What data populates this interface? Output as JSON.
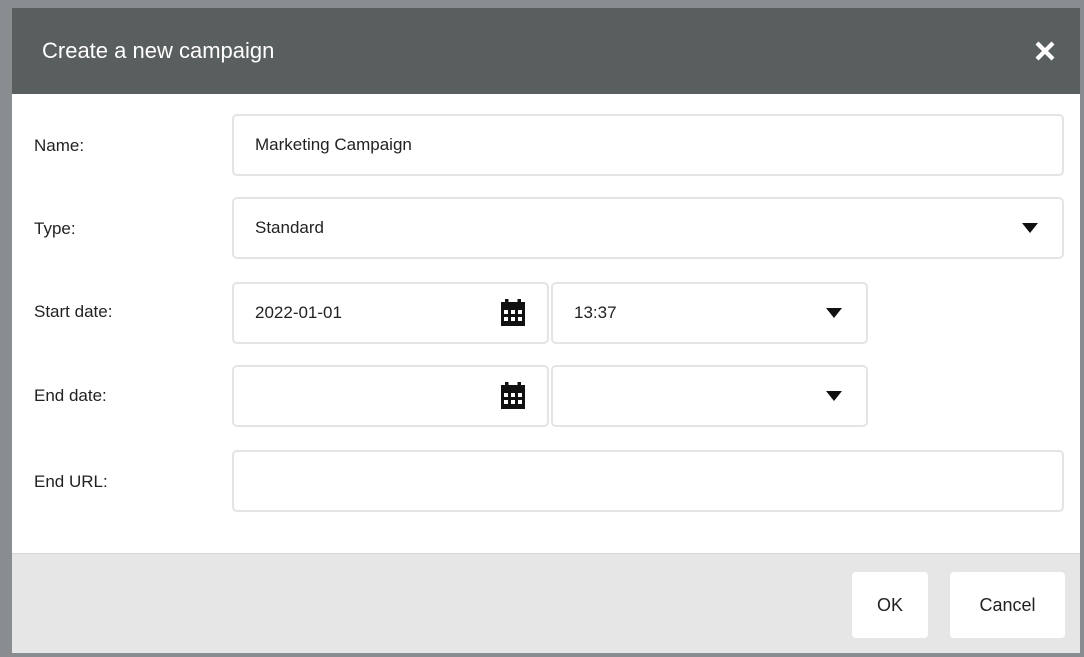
{
  "dialog": {
    "title": "Create a new campaign",
    "close_icon": "close-icon"
  },
  "form": {
    "name": {
      "label": "Name:",
      "value": "Marketing Campaign"
    },
    "type": {
      "label": "Type:",
      "value": "Standard"
    },
    "start_date": {
      "label": "Start date:",
      "date": "2022-01-01",
      "time": "13:37"
    },
    "end_date": {
      "label": "End date:",
      "date": "",
      "time": ""
    },
    "end_url": {
      "label": "End URL:",
      "value": ""
    }
  },
  "footer": {
    "ok_label": "OK",
    "cancel_label": "Cancel"
  },
  "icons": {
    "calendar": "calendar-icon",
    "dropdown": "caret-down-icon"
  },
  "colors": {
    "titlebar": "#595e5f",
    "footer": "#e6e6e6",
    "border": "#e4e4e4"
  }
}
